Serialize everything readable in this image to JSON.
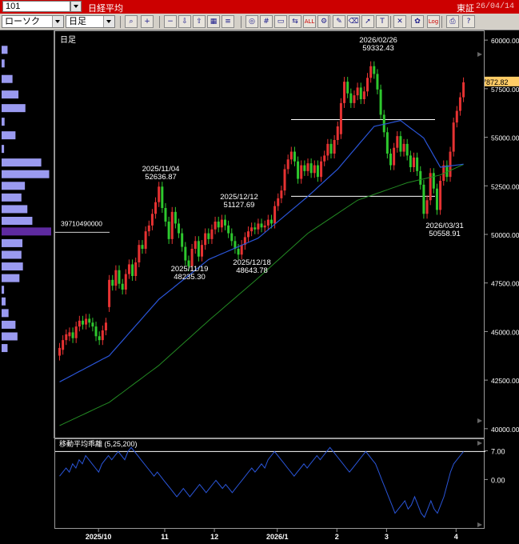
{
  "title_bar": {
    "symbol_code": "101",
    "index_name": "日経平均",
    "exchange": "東証",
    "date": "26/04/14",
    "bg_color": "#cc0000"
  },
  "toolbar": {
    "chart_type": "ローソク",
    "period": "日足",
    "icons": [
      "magnifier-icon",
      "zoom-in-icon",
      "zoom-out-icon",
      "save-down-icon",
      "save-up-icon",
      "chart-icon",
      "list-icon",
      "reset-icon",
      "grid-icon",
      "window-icon",
      "compare-icon",
      "all-icon",
      "settings-icon",
      "draw-pen-icon",
      "erase-icon",
      "cursor-icon",
      "text-tool-icon",
      "delete-icon",
      "gear-icon",
      "log-scale-icon",
      "print-icon",
      "help-icon"
    ],
    "all_label": "ALL",
    "log_label": "Log"
  },
  "volume_profile": {
    "peak_volume_label": "39710490000",
    "bar_color": "#9a9af0",
    "peak_color": "#5e2aa0",
    "bars": [
      {
        "price": 59500,
        "volume": 0.12
      },
      {
        "price": 58800,
        "volume": 0.06
      },
      {
        "price": 58000,
        "volume": 0.22
      },
      {
        "price": 57200,
        "volume": 0.34
      },
      {
        "price": 56500,
        "volume": 0.48
      },
      {
        "price": 55800,
        "volume": 0.06
      },
      {
        "price": 55100,
        "volume": 0.28
      },
      {
        "price": 54400,
        "volume": 0.05
      },
      {
        "price": 53700,
        "volume": 0.8
      },
      {
        "price": 53100,
        "volume": 0.96
      },
      {
        "price": 52500,
        "volume": 0.47
      },
      {
        "price": 51900,
        "volume": 0.4
      },
      {
        "price": 51300,
        "volume": 0.52
      },
      {
        "price": 50700,
        "volume": 0.62
      },
      {
        "price": 50150,
        "volume": 1.0
      },
      {
        "price": 49550,
        "volume": 0.42
      },
      {
        "price": 48950,
        "volume": 0.4
      },
      {
        "price": 48350,
        "volume": 0.43
      },
      {
        "price": 47750,
        "volume": 0.36
      },
      {
        "price": 47150,
        "volume": 0.05
      },
      {
        "price": 46550,
        "volume": 0.08
      },
      {
        "price": 45950,
        "volume": 0.14
      },
      {
        "price": 45350,
        "volume": 0.28
      },
      {
        "price": 44750,
        "volume": 0.32
      },
      {
        "price": 44150,
        "volume": 0.12
      }
    ]
  },
  "main_chart": {
    "period_label": "日足",
    "y_axis_ticks": [
      "60000.00",
      "57500.00",
      "55000.00",
      "52500.00",
      "50000.00",
      "47500.00",
      "45000.00",
      "42500.00",
      "40000.00"
    ],
    "current_price_label": "57872.82",
    "annotations": [
      {
        "date": "2026/02/26",
        "value": "59332.43"
      },
      {
        "date": "2025/11/04",
        "value": "52636.87"
      },
      {
        "date": "2025/12/12",
        "value": "51127.69"
      },
      {
        "date": "2025/11/19",
        "value": "48235.30"
      },
      {
        "date": "2025/12/18",
        "value": "48643.78"
      },
      {
        "date": "2026/03/31",
        "value": "50558.91"
      }
    ],
    "colors": {
      "up": "#e63232",
      "down": "#2ec82e",
      "ma_short": "#2a55d8",
      "ma_long": "#238a23",
      "price_tag": "#ffcc66"
    }
  },
  "chart_data": {
    "type": "candlestick",
    "title": "",
    "ylim": [
      39500,
      60500
    ],
    "x_ticks": [
      "2025/10",
      "11",
      "12",
      "2026/1",
      "2",
      "3",
      "4"
    ],
    "support_resistance_levels": [
      55950,
      52000
    ],
    "candles": [
      {
        "o": 43800,
        "c": 44200
      },
      {
        "o": 44100,
        "c": 44600
      },
      {
        "o": 44600,
        "c": 44900
      },
      {
        "o": 44800,
        "c": 45000
      },
      {
        "o": 45000,
        "c": 44700
      },
      {
        "o": 44700,
        "c": 45300
      },
      {
        "o": 45300,
        "c": 45600
      },
      {
        "o": 45600,
        "c": 45400
      },
      {
        "o": 45400,
        "c": 45700
      },
      {
        "o": 45700,
        "c": 45500
      },
      {
        "o": 45500,
        "c": 45300
      },
      {
        "o": 45300,
        "c": 44800
      },
      {
        "o": 44800,
        "c": 44600
      },
      {
        "o": 44600,
        "c": 45100
      },
      {
        "o": 45100,
        "c": 45500
      },
      {
        "o": 46300,
        "c": 47700
      },
      {
        "o": 47700,
        "c": 47400
      },
      {
        "o": 47400,
        "c": 48200
      },
      {
        "o": 48200,
        "c": 47500
      },
      {
        "o": 47500,
        "c": 47200
      },
      {
        "o": 47200,
        "c": 48000
      },
      {
        "o": 48000,
        "c": 48500
      },
      {
        "o": 48500,
        "c": 47900
      },
      {
        "o": 47900,
        "c": 48600
      },
      {
        "o": 48600,
        "c": 49500
      },
      {
        "o": 49500,
        "c": 49300
      },
      {
        "o": 49300,
        "c": 50200
      },
      {
        "o": 50200,
        "c": 50500
      },
      {
        "o": 50500,
        "c": 51100
      },
      {
        "o": 51100,
        "c": 51700
      },
      {
        "o": 51700,
        "c": 52500
      },
      {
        "o": 52500,
        "c": 51400
      },
      {
        "o": 51400,
        "c": 50700
      },
      {
        "o": 50700,
        "c": 49800
      },
      {
        "o": 49800,
        "c": 51200
      },
      {
        "o": 51200,
        "c": 50600
      },
      {
        "o": 50600,
        "c": 50100
      },
      {
        "o": 50100,
        "c": 49400
      },
      {
        "o": 49400,
        "c": 48700
      },
      {
        "o": 48700,
        "c": 48400
      },
      {
        "o": 48400,
        "c": 49300
      },
      {
        "o": 49300,
        "c": 49700
      },
      {
        "o": 49700,
        "c": 48900
      },
      {
        "o": 48900,
        "c": 49500
      },
      {
        "o": 49500,
        "c": 50100
      },
      {
        "o": 50100,
        "c": 49800
      },
      {
        "o": 49800,
        "c": 50300
      },
      {
        "o": 50300,
        "c": 50700
      },
      {
        "o": 50700,
        "c": 50400
      },
      {
        "o": 50400,
        "c": 50800
      },
      {
        "o": 50800,
        "c": 50500
      },
      {
        "o": 50500,
        "c": 50100
      },
      {
        "o": 50100,
        "c": 49700
      },
      {
        "o": 49700,
        "c": 49300
      },
      {
        "o": 49300,
        "c": 49000
      },
      {
        "o": 49000,
        "c": 49500
      },
      {
        "o": 49500,
        "c": 49900
      },
      {
        "o": 49900,
        "c": 50200
      },
      {
        "o": 50200,
        "c": 50400
      },
      {
        "o": 50400,
        "c": 50300
      },
      {
        "o": 50300,
        "c": 50600
      },
      {
        "o": 50600,
        "c": 50400
      },
      {
        "o": 50400,
        "c": 50500
      },
      {
        "o": 50500,
        "c": 50800
      },
      {
        "o": 50800,
        "c": 50600
      },
      {
        "o": 50600,
        "c": 51500
      },
      {
        "o": 51500,
        "c": 51900
      },
      {
        "o": 51900,
        "c": 52300
      },
      {
        "o": 52300,
        "c": 53400
      },
      {
        "o": 53400,
        "c": 53900
      },
      {
        "o": 53900,
        "c": 54300
      },
      {
        "o": 54300,
        "c": 53800
      },
      {
        "o": 53800,
        "c": 52900
      },
      {
        "o": 52900,
        "c": 53600
      },
      {
        "o": 53600,
        "c": 53300
      },
      {
        "o": 53300,
        "c": 53700
      },
      {
        "o": 53700,
        "c": 53200
      },
      {
        "o": 53200,
        "c": 53600
      },
      {
        "o": 53600,
        "c": 53000
      },
      {
        "o": 53000,
        "c": 53800
      },
      {
        "o": 53800,
        "c": 54100
      },
      {
        "o": 54100,
        "c": 54700
      },
      {
        "o": 54700,
        "c": 54200
      },
      {
        "o": 54200,
        "c": 54900
      },
      {
        "o": 54900,
        "c": 55600
      },
      {
        "o": 55200,
        "c": 56800
      },
      {
        "o": 56800,
        "c": 57900
      },
      {
        "o": 57900,
        "c": 57300
      },
      {
        "o": 57300,
        "c": 56800
      },
      {
        "o": 56800,
        "c": 57200
      },
      {
        "o": 57200,
        "c": 57600
      },
      {
        "o": 57600,
        "c": 57000
      },
      {
        "o": 57000,
        "c": 57400
      },
      {
        "o": 57400,
        "c": 58100
      },
      {
        "o": 58100,
        "c": 58700
      },
      {
        "o": 58700,
        "c": 58300
      },
      {
        "o": 58300,
        "c": 57500
      },
      {
        "o": 57500,
        "c": 56200
      },
      {
        "o": 56200,
        "c": 55300
      },
      {
        "o": 55300,
        "c": 54200
      },
      {
        "o": 54200,
        "c": 53600
      },
      {
        "o": 53600,
        "c": 54500
      },
      {
        "o": 54500,
        "c": 55100
      },
      {
        "o": 55100,
        "c": 54300
      },
      {
        "o": 54300,
        "c": 54700
      },
      {
        "o": 54700,
        "c": 54100
      },
      {
        "o": 54100,
        "c": 53500
      },
      {
        "o": 53500,
        "c": 54000
      },
      {
        "o": 54000,
        "c": 53300
      },
      {
        "o": 53300,
        "c": 52600
      },
      {
        "o": 52600,
        "c": 51100
      },
      {
        "o": 51100,
        "c": 51800
      },
      {
        "o": 51800,
        "c": 53200
      },
      {
        "o": 53200,
        "c": 52400
      },
      {
        "o": 52400,
        "c": 51300
      },
      {
        "o": 51300,
        "c": 52800
      },
      {
        "o": 52800,
        "c": 53600
      },
      {
        "o": 53600,
        "c": 53000
      },
      {
        "o": 53000,
        "c": 54300
      },
      {
        "o": 54300,
        "c": 55800
      },
      {
        "o": 55800,
        "c": 56400
      },
      {
        "o": 56400,
        "c": 57100
      },
      {
        "o": 57100,
        "c": 57870
      }
    ],
    "ma_short_anchors": [
      [
        0,
        42450
      ],
      [
        15,
        43800
      ],
      [
        30,
        46700
      ],
      [
        45,
        48750
      ],
      [
        60,
        49850
      ],
      [
        75,
        52000
      ],
      [
        84,
        53400
      ],
      [
        95,
        55600
      ],
      [
        103,
        55900
      ],
      [
        110,
        55000
      ],
      [
        115,
        53500
      ],
      [
        124,
        53700
      ]
    ],
    "ma_long_anchors": [
      [
        0,
        40200
      ],
      [
        15,
        41400
      ],
      [
        30,
        43300
      ],
      [
        45,
        45600
      ],
      [
        60,
        47800
      ],
      [
        75,
        50100
      ],
      [
        90,
        51800
      ],
      [
        105,
        52700
      ],
      [
        115,
        53100
      ],
      [
        124,
        53800
      ]
    ]
  },
  "oscillator": {
    "label": "移動平均乖離 (5,25,200)",
    "y_axis_ticks": [
      "7.00",
      "0.00"
    ],
    "ylim": [
      -12,
      10
    ],
    "reference_line": 7,
    "color": "#2a55d8",
    "values": [
      1,
      2,
      3,
      2,
      4,
      3,
      5,
      4,
      6,
      5,
      4,
      3,
      2,
      4,
      5,
      6,
      5,
      6,
      7,
      6,
      5,
      7,
      8,
      7,
      6,
      5,
      4,
      3,
      2,
      1,
      2,
      1,
      0,
      -1,
      -2,
      -3,
      -4,
      -3,
      -2,
      -3,
      -4,
      -3,
      -2,
      -1,
      -2,
      -3,
      -2,
      -1,
      0,
      -1,
      -2,
      -1,
      -2,
      -3,
      -2,
      -1,
      0,
      1,
      2,
      3,
      2,
      3,
      4,
      3,
      5,
      6,
      7,
      6,
      5,
      4,
      3,
      2,
      1,
      2,
      3,
      4,
      3,
      4,
      5,
      6,
      5,
      6,
      7,
      8,
      7,
      6,
      5,
      4,
      3,
      2,
      3,
      4,
      5,
      6,
      7,
      6,
      5,
      4,
      2,
      0,
      -2,
      -4,
      -6,
      -8,
      -7,
      -6,
      -5,
      -7,
      -6,
      -4,
      -6,
      -8,
      -9,
      -7,
      -5,
      -7,
      -8,
      -6,
      -4,
      -1,
      2,
      4,
      5,
      6,
      7
    ]
  }
}
